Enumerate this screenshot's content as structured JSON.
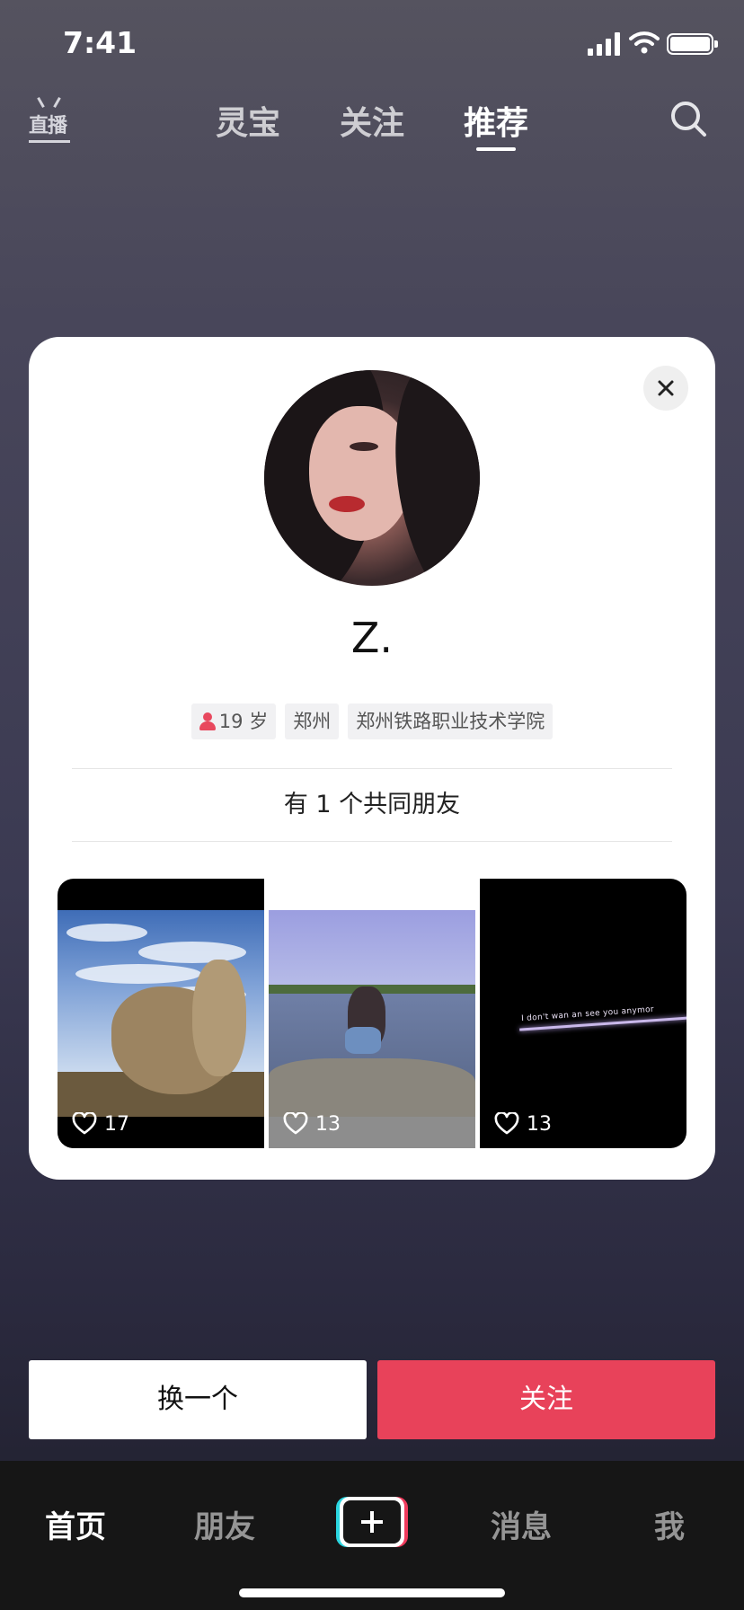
{
  "status_bar": {
    "time": "7:41"
  },
  "top_nav": {
    "live_label": "直播",
    "tabs": [
      {
        "label": "灵宝",
        "active": false
      },
      {
        "label": "关注",
        "active": false
      },
      {
        "label": "推荐",
        "active": true
      }
    ]
  },
  "card": {
    "username": "Z.",
    "tags": {
      "age": "19 岁",
      "city": "郑州",
      "school": "郑州铁路职业技术学院"
    },
    "mutual_friends": "有 1 个共同朋友",
    "videos": [
      {
        "likes": "17"
      },
      {
        "likes": "13"
      },
      {
        "likes": "13",
        "caption": "I don't wan an see you anymor"
      }
    ]
  },
  "actions": {
    "change_label": "换一个",
    "follow_label": "关注"
  },
  "tab_bar": {
    "items": [
      {
        "label": "首页",
        "active": true
      },
      {
        "label": "朋友",
        "active": false
      },
      {
        "label": "消息",
        "active": false
      },
      {
        "label": "我",
        "active": false
      }
    ]
  },
  "colors": {
    "accent": "#e8425a",
    "gender_female": "#e8485e",
    "tab_bar_bg": "#161616"
  },
  "icons": [
    "signal-icon",
    "wifi-icon",
    "battery-icon",
    "live-icon",
    "search-icon",
    "close-icon",
    "gender-female-icon",
    "heart-icon",
    "plus-icon"
  ]
}
